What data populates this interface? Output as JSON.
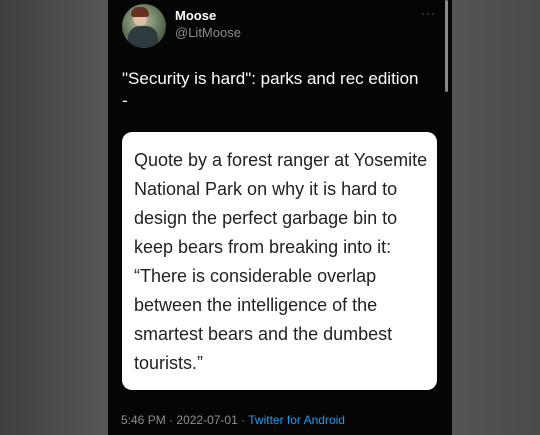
{
  "tweet": {
    "author_name": "Moose",
    "author_handle": "@LitMoose",
    "more_icon": "more-dots-icon",
    "text": "\"Security is hard\": parks and rec edition -",
    "quote_card": "Quote by a forest ranger at Yosemite National Park on why it is hard to design the perfect garbage bin to keep bears from breaking into it:  “There is considerable overlap between the intelligence of the smartest bears and the dumbest tourists.”",
    "time": "5:46 PM",
    "date": "2022-07-01",
    "separator": "·",
    "source": "Twitter for Android"
  },
  "colors": {
    "background": "#050505",
    "link": "#1d9bf0",
    "muted": "#8b8f93"
  }
}
